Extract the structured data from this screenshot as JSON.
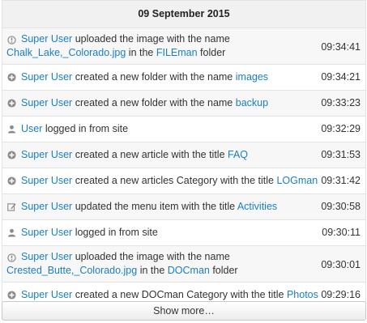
{
  "date_header": "09 September 2015",
  "entries": [
    {
      "icon": "upload-icon",
      "actor": "Super User",
      "action": " uploaded the image with the name ",
      "target": "Chalk_Lake,_Colorado.jpg",
      "suffix_pre": " in the ",
      "suffix_link": "FILEman",
      "suffix_post": " folder",
      "time": "09:34:41"
    },
    {
      "icon": "plus-icon",
      "actor": "Super User",
      "action": " created a new folder with the name ",
      "target": "images",
      "time": "09:34:21"
    },
    {
      "icon": "plus-icon",
      "actor": "Super User",
      "action": " created a new folder with the name ",
      "target": "backup",
      "time": "09:33:23"
    },
    {
      "icon": "user-icon",
      "actor": "User",
      "action": " logged in from site",
      "time": "09:32:29"
    },
    {
      "icon": "plus-icon",
      "actor": "Super User",
      "action": " created a new article with the title ",
      "target": "FAQ",
      "time": "09:31:53"
    },
    {
      "icon": "plus-icon",
      "actor": "Super User",
      "action": " created a new articles Category with the title ",
      "target": "LOGman",
      "time": "09:31:42"
    },
    {
      "icon": "edit-icon",
      "actor": "Super User",
      "action": " updated the menu item with the title ",
      "target": "Activities",
      "time": "09:30:58"
    },
    {
      "icon": "user-icon",
      "actor": "Super User",
      "action": " logged in from site",
      "time": "09:30:11"
    },
    {
      "icon": "upload-icon",
      "actor": "Super User",
      "action": " uploaded the image with the name ",
      "target": "Crested_Butte,_Colorado.jpg",
      "suffix_pre": " in the ",
      "suffix_link": "DOCman",
      "suffix_post": " folder",
      "time": "09:30:01"
    },
    {
      "icon": "plus-icon",
      "actor": "Super User",
      "action": " created a new DOCman Category with the title ",
      "target": "Photos",
      "time": "09:29:16"
    }
  ],
  "show_more_label": "Show more…"
}
